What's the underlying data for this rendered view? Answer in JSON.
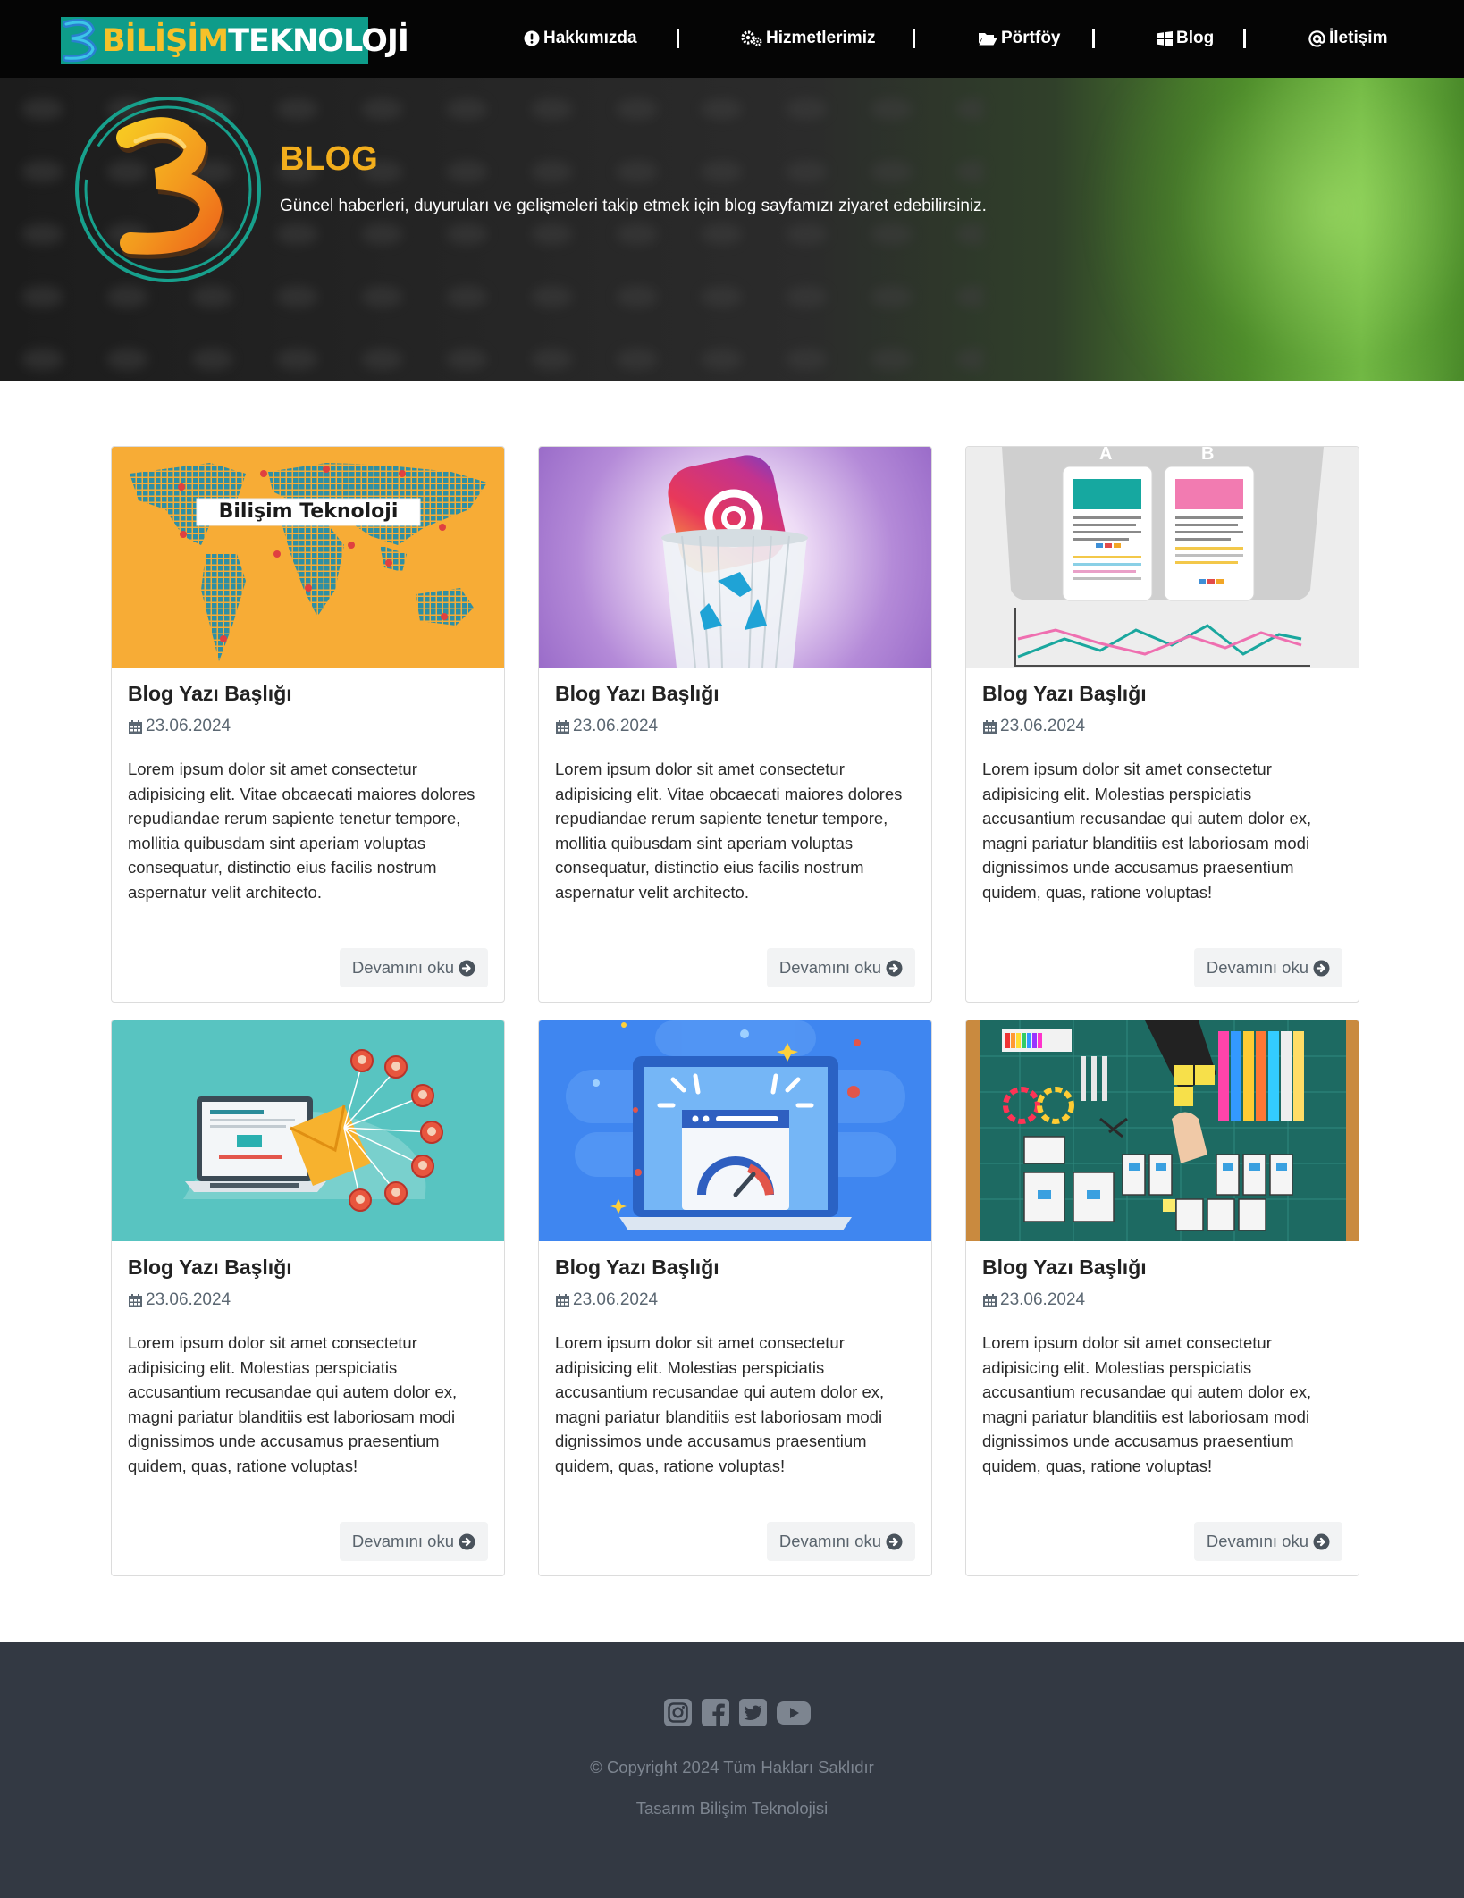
{
  "brand": {
    "logo_word1": "BİLİŞİM",
    "logo_word2": "TEKNOLOJİ"
  },
  "nav": {
    "items": [
      {
        "label": "Hakkımızda",
        "icon": "info-circle-icon"
      },
      {
        "label": "Hizmetlerimiz",
        "icon": "gears-icon"
      },
      {
        "label": "Pörtföy",
        "icon": "folder-open-icon"
      },
      {
        "label": "Blog",
        "icon": "windows-icon"
      },
      {
        "label": "İletişim",
        "icon": "at-icon"
      }
    ]
  },
  "hero": {
    "title": "BLOG",
    "subtitle": "Güncel haberleri, duyuruları ve gelişmeleri takip etmek için blog sayfamızı ziyaret edebilirsiniz."
  },
  "posts": [
    {
      "title": "Blog Yazı Başlığı",
      "date": "23.06.2024",
      "image": "world-map-illustration",
      "image_caption": "Bilişim Teknoloji",
      "text": "Lorem ipsum dolor sit amet consectetur adipisicing elit. Vitae obcaecati maiores dolores repudiandae rerum sapiente tenetur tempore, mollitia quibusdam sint aperiam voluptas consequatur, distinctio eius facilis nostrum aspernatur velit architecto.",
      "button": "Devamını oku"
    },
    {
      "title": "Blog Yazı Başlığı",
      "date": "23.06.2024",
      "image": "instagram-trash-illustration",
      "text": "Lorem ipsum dolor sit amet consectetur adipisicing elit. Vitae obcaecati maiores dolores repudiandae rerum sapiente tenetur tempore, mollitia quibusdam sint aperiam voluptas consequatur, distinctio eius facilis nostrum aspernatur velit architecto.",
      "button": "Devamını oku"
    },
    {
      "title": "Blog Yazı Başlığı",
      "date": "23.06.2024",
      "image": "ab-test-illustration",
      "image_label_a": "A",
      "image_label_b": "B",
      "text": "Lorem ipsum dolor sit amet consectetur adipisicing elit. Molestias perspiciatis accusantium recusandae qui autem dolor ex, magni pariatur blanditiis est laboriosam modi dignissimos unde accusamus praesentium quidem, quas, ratione voluptas!",
      "button": "Devamını oku"
    },
    {
      "title": "Blog Yazı Başlığı",
      "date": "23.06.2024",
      "image": "email-marketing-illustration",
      "text": "Lorem ipsum dolor sit amet consectetur adipisicing elit. Molestias perspiciatis accusantium recusandae qui autem dolor ex, magni pariatur blanditiis est laboriosam modi dignissimos unde accusamus praesentium quidem, quas, ratione voluptas!",
      "button": "Devamını oku"
    },
    {
      "title": "Blog Yazı Başlığı",
      "date": "23.06.2024",
      "image": "page-speed-illustration",
      "text": "Lorem ipsum dolor sit amet consectetur adipisicing elit. Molestias perspiciatis accusantium recusandae qui autem dolor ex, magni pariatur blanditiis est laboriosam modi dignissimos unde accusamus praesentium quidem, quas, ratione voluptas!",
      "button": "Devamını oku"
    },
    {
      "title": "Blog Yazı Başlığı",
      "date": "23.06.2024",
      "image": "ux-wireframe-photo",
      "text": "Lorem ipsum dolor sit amet consectetur adipisicing elit. Molestias perspiciatis accusantium recusandae qui autem dolor ex, magni pariatur blanditiis est laboriosam modi dignissimos unde accusamus praesentium quidem, quas, ratione voluptas!",
      "button": "Devamını oku"
    }
  ],
  "footer": {
    "socials": [
      "instagram-icon",
      "facebook-icon",
      "twitter-icon",
      "youtube-icon"
    ],
    "copyright": "© Copyright 2024 Tüm Hakları Saklıdır",
    "design": "Tasarım Bilişim Teknolojisi"
  },
  "colors": {
    "navbar_bg": "#050505",
    "logo_bg": "#0e9c8a",
    "hero_title": "#f3ae1c",
    "footer_bg": "#333943",
    "footer_text": "#7d8590"
  }
}
